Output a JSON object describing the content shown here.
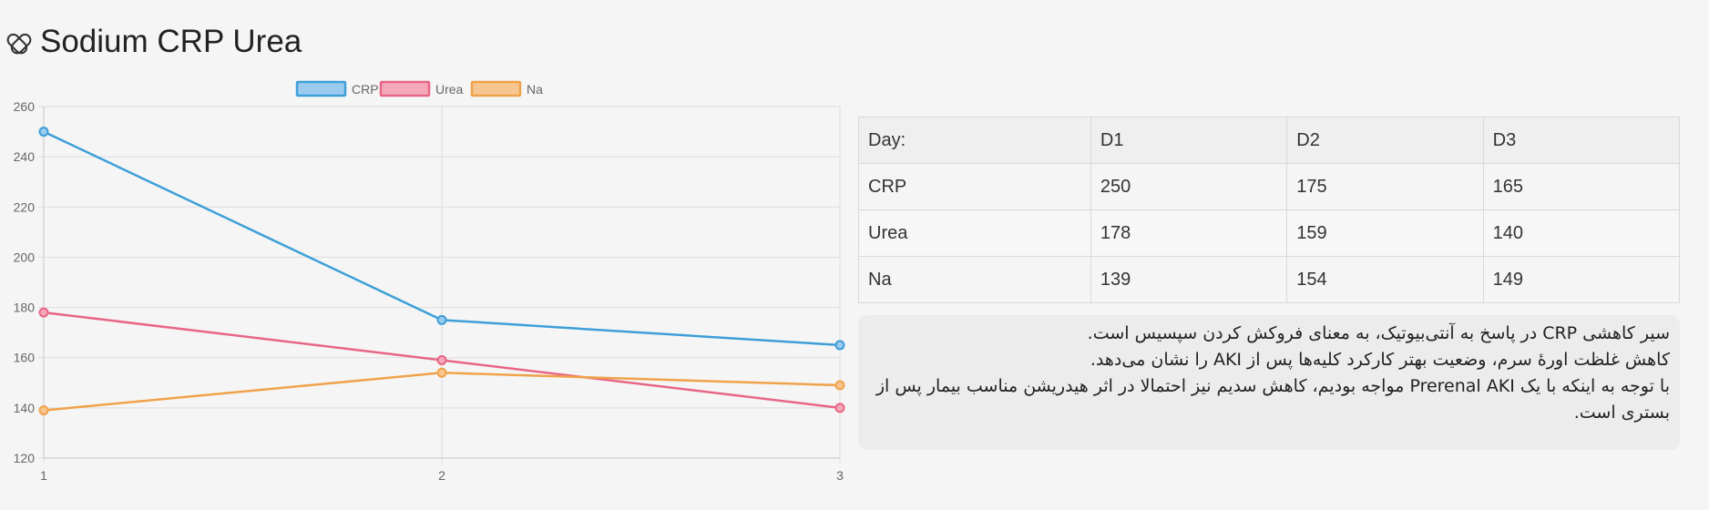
{
  "page": {
    "title": "Sodium CRP Urea",
    "icon": "pill-capsule-icon"
  },
  "chart_data": {
    "type": "line",
    "x": [
      1,
      2,
      3
    ],
    "x_tick_labels": [
      "1",
      "2",
      "3"
    ],
    "ylim": [
      120,
      260
    ],
    "y_ticks": [
      120,
      140,
      160,
      180,
      200,
      220,
      240,
      260
    ],
    "grid": true,
    "legend_position": "top",
    "series": [
      {
        "name": "CRP",
        "values": [
          250,
          175,
          165
        ],
        "color": "#3e9fd8",
        "fill": "#9acbee"
      },
      {
        "name": "Urea",
        "values": [
          178,
          159,
          140
        ],
        "color": "#e86685",
        "fill": "#f5a8ba"
      },
      {
        "name": "Na",
        "values": [
          139,
          154,
          149
        ],
        "color": "#f0a24a",
        "fill": "#f7c690"
      }
    ]
  },
  "table": {
    "header": [
      "Day:",
      "D1",
      "D2",
      "D3"
    ],
    "rows": [
      [
        "CRP",
        "250",
        "175",
        "165"
      ],
      [
        "Urea",
        "178",
        "159",
        "140"
      ],
      [
        "Na",
        "139",
        "154",
        "149"
      ]
    ]
  },
  "notes": [
    "سیر کاهشی CRP در پاسخ به آنتی‌بیوتیک، به معنای فروکش کردن سپسیس است.",
    "کاهش غلظت اورهٔ سرم، وضعیت بهتر کارکرد کلیه‌ها پس از AKI را نشان می‌دهد.",
    "با توجه به اینکه با یک Prerenal AKI مواجه بودیم، کاهش سدیم نیز احتمالا در اثر هیدریشن مناسب بیمار پس از بستری است."
  ]
}
